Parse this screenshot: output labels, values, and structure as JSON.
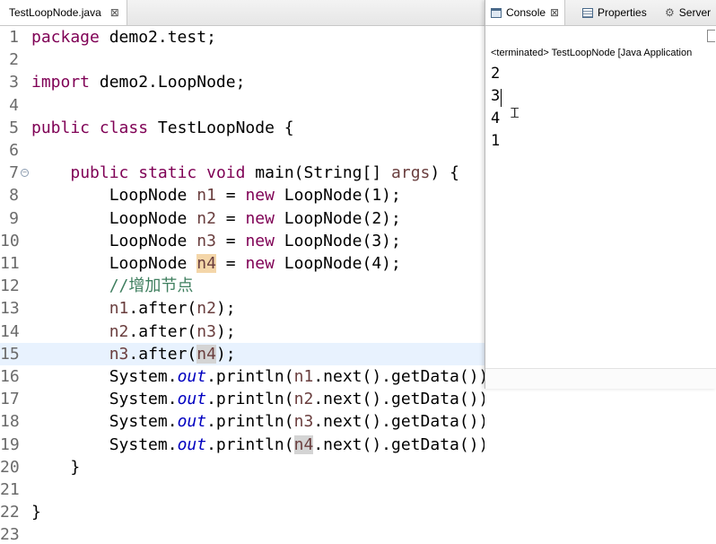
{
  "editor": {
    "tab_label": "TestLoopNode.java",
    "tab_close": "⊠",
    "lines": [
      {
        "n": "1",
        "segs": [
          {
            "t": "package",
            "c": "kw"
          },
          {
            "t": " demo2.test;"
          }
        ]
      },
      {
        "n": "2",
        "segs": []
      },
      {
        "n": "3",
        "segs": [
          {
            "t": "import",
            "c": "kw"
          },
          {
            "t": " demo2.LoopNode;"
          }
        ]
      },
      {
        "n": "4",
        "segs": []
      },
      {
        "n": "5",
        "segs": [
          {
            "t": "public",
            "c": "kw"
          },
          {
            "t": " "
          },
          {
            "t": "class",
            "c": "kw"
          },
          {
            "t": " TestLoopNode {"
          }
        ]
      },
      {
        "n": "6",
        "segs": []
      },
      {
        "n": "7",
        "fold": true,
        "segs": [
          {
            "t": "    "
          },
          {
            "t": "public",
            "c": "kw"
          },
          {
            "t": " "
          },
          {
            "t": "static",
            "c": "kw"
          },
          {
            "t": " "
          },
          {
            "t": "void",
            "c": "kw"
          },
          {
            "t": " main(String[] "
          },
          {
            "t": "args",
            "c": "var"
          },
          {
            "t": ") {"
          }
        ]
      },
      {
        "n": "8",
        "segs": [
          {
            "t": "        LoopNode "
          },
          {
            "t": "n1",
            "c": "var"
          },
          {
            "t": " = "
          },
          {
            "t": "new",
            "c": "kw"
          },
          {
            "t": " LoopNode(1);"
          }
        ]
      },
      {
        "n": "9",
        "segs": [
          {
            "t": "        LoopNode "
          },
          {
            "t": "n2",
            "c": "var"
          },
          {
            "t": " = "
          },
          {
            "t": "new",
            "c": "kw"
          },
          {
            "t": " LoopNode(2);"
          }
        ]
      },
      {
        "n": "10",
        "segs": [
          {
            "t": "        LoopNode "
          },
          {
            "t": "n3",
            "c": "var"
          },
          {
            "t": " = "
          },
          {
            "t": "new",
            "c": "kw"
          },
          {
            "t": " LoopNode(3);"
          }
        ]
      },
      {
        "n": "11",
        "segs": [
          {
            "t": "        LoopNode "
          },
          {
            "t": "n4",
            "c": "var hl-orange"
          },
          {
            "t": " = "
          },
          {
            "t": "new",
            "c": "kw"
          },
          {
            "t": " LoopNode(4);"
          }
        ]
      },
      {
        "n": "12",
        "segs": [
          {
            "t": "        "
          },
          {
            "t": "//增加节点",
            "c": "cmt"
          }
        ]
      },
      {
        "n": "13",
        "segs": [
          {
            "t": "        "
          },
          {
            "t": "n1",
            "c": "var"
          },
          {
            "t": ".after("
          },
          {
            "t": "n2",
            "c": "var"
          },
          {
            "t": ");"
          }
        ]
      },
      {
        "n": "14",
        "segs": [
          {
            "t": "        "
          },
          {
            "t": "n2",
            "c": "var"
          },
          {
            "t": ".after("
          },
          {
            "t": "n3",
            "c": "var"
          },
          {
            "t": ");"
          }
        ]
      },
      {
        "n": "15",
        "current": true,
        "segs": [
          {
            "t": "        "
          },
          {
            "t": "n3",
            "c": "var"
          },
          {
            "t": ".after("
          },
          {
            "t": "n4",
            "c": "var hl-grey"
          },
          {
            "t": ");"
          }
        ]
      },
      {
        "n": "16",
        "segs": [
          {
            "t": "        System."
          },
          {
            "t": "out",
            "c": "st"
          },
          {
            "t": ".println("
          },
          {
            "t": "n1",
            "c": "var"
          },
          {
            "t": ".next().getData());"
          }
        ]
      },
      {
        "n": "17",
        "segs": [
          {
            "t": "        System."
          },
          {
            "t": "out",
            "c": "st"
          },
          {
            "t": ".println("
          },
          {
            "t": "n2",
            "c": "var"
          },
          {
            "t": ".next().getData());"
          }
        ]
      },
      {
        "n": "18",
        "segs": [
          {
            "t": "        System."
          },
          {
            "t": "out",
            "c": "st"
          },
          {
            "t": ".println("
          },
          {
            "t": "n3",
            "c": "var"
          },
          {
            "t": ".next().getData());"
          }
        ]
      },
      {
        "n": "19",
        "segs": [
          {
            "t": "        System."
          },
          {
            "t": "out",
            "c": "st"
          },
          {
            "t": ".println("
          },
          {
            "t": "n4",
            "c": "var hl-grey"
          },
          {
            "t": ".next().getData());"
          }
        ]
      },
      {
        "n": "20",
        "segs": [
          {
            "t": "    }"
          }
        ]
      },
      {
        "n": "21",
        "segs": []
      },
      {
        "n": "22",
        "segs": [
          {
            "t": "}"
          }
        ]
      },
      {
        "n": "23",
        "segs": []
      }
    ]
  },
  "console": {
    "tabs": {
      "console": "Console",
      "console_close": "⊠",
      "properties": "Properties",
      "servers": "Server"
    },
    "status": "<terminated> TestLoopNode [Java Application",
    "output": [
      "2",
      "3",
      "4",
      "1"
    ]
  },
  "colors": {
    "keyword": "#7f0055",
    "variable": "#6a3e3e",
    "comment": "#3f7f5f",
    "static_field": "#0000c0",
    "current_line": "#e8f2fe",
    "occurrence_write": "#f4d6a9",
    "occurrence_read": "#d4d4d4"
  },
  "icons": {
    "console_tab": "console-icon",
    "properties_tab": "properties-icon",
    "servers_tab": "servers-icon",
    "fold": "collapse-icon",
    "cursor": "ibeam-cursor-icon"
  }
}
